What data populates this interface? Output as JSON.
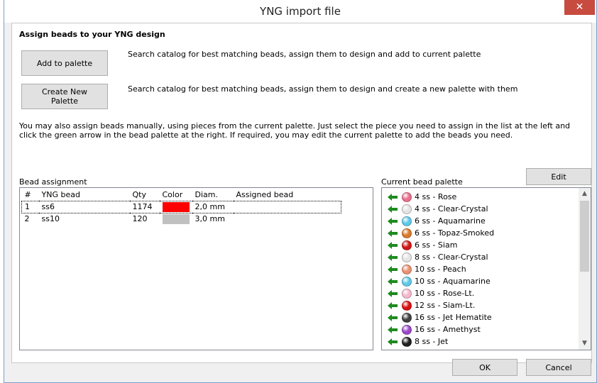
{
  "window": {
    "title": "YNG import file",
    "close_label": "✕"
  },
  "section_title": "Assign beads to your YNG design",
  "actions": [
    {
      "label": "Add to palette",
      "description": "Search catalog for best matching beads, assign them to design and add to current palette"
    },
    {
      "label": "Create New\nPalette",
      "description": "Search catalog for best matching beads, assign them to design and create a new palette with them"
    }
  ],
  "info_text": "You may also assign beads manually, using pieces from the current palette. Just select the piece you need to assign in the list at the left and click the green arrow in the bead palette at the right. If required, you may edit the current palette to add the beads you need.",
  "bead_assignment": {
    "label": "Bead assignment",
    "columns": [
      "#",
      "YNG bead",
      "Qty",
      "Color",
      "Diam.",
      "Assigned bead"
    ],
    "rows": [
      {
        "num": "1",
        "bead": "ss6",
        "qty": "1174",
        "color": "#ff0000",
        "diam": "2,0 mm",
        "assigned": ""
      },
      {
        "num": "2",
        "bead": "ss10",
        "qty": "120",
        "color": "#c0c0c0",
        "diam": "3,0 mm",
        "assigned": ""
      }
    ]
  },
  "palette": {
    "label": "Current bead palette",
    "edit_label": "Edit",
    "items": [
      {
        "label": "4 ss - Rose",
        "color": "#e8718e"
      },
      {
        "label": "4 ss - Clear-Crystal",
        "color": "#e4e4e4"
      },
      {
        "label": "6 ss - Aquamarine",
        "color": "#5fc8e8"
      },
      {
        "label": "6 ss - Topaz-Smoked",
        "color": "#d8782a"
      },
      {
        "label": "6 ss - Siam",
        "color": "#d01818"
      },
      {
        "label": "8 ss - Clear-Crystal",
        "color": "#e4e4e4"
      },
      {
        "label": "10 ss - Peach",
        "color": "#e89070"
      },
      {
        "label": "10 ss - Aquamarine",
        "color": "#5fc8e8"
      },
      {
        "label": "10 ss - Rose-Lt.",
        "color": "#f4b8cc"
      },
      {
        "label": "12 ss - Siam-Lt.",
        "color": "#d81010"
      },
      {
        "label": "16 ss - Jet Hematite",
        "color": "#404040"
      },
      {
        "label": "16 ss - Amethyst",
        "color": "#9a48c8"
      },
      {
        "label": "8 ss - Jet",
        "color": "#202020"
      }
    ]
  },
  "footer": {
    "ok_label": "OK",
    "cancel_label": "Cancel"
  }
}
